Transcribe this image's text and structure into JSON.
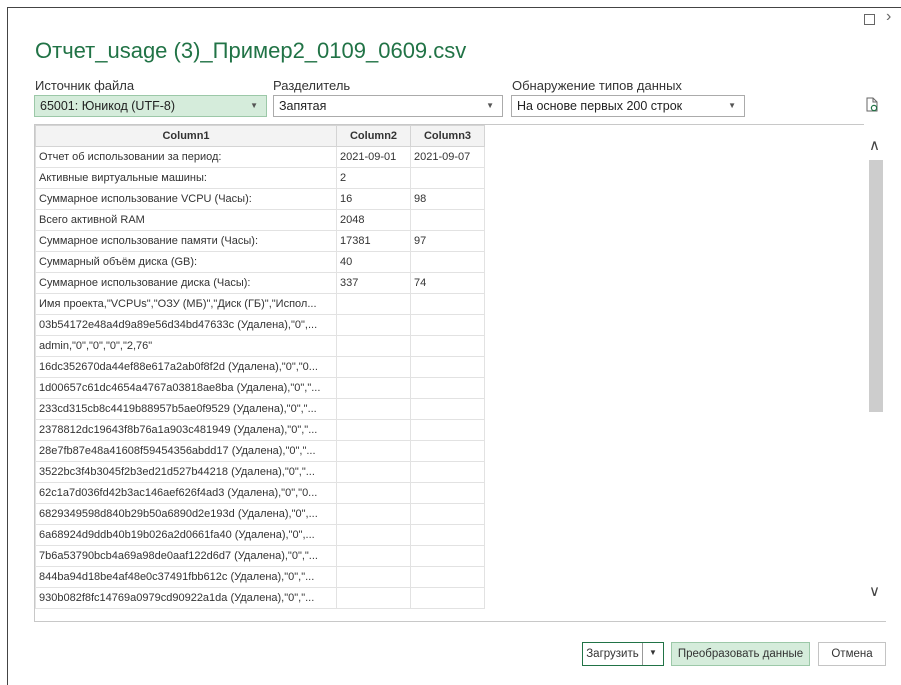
{
  "window": {
    "title": "Отчет_usage (3)_Пример2_0109_0609.csv"
  },
  "options": {
    "file_origin_label": "Источник файла",
    "file_origin_value": "65001: Юникод (UTF-8)",
    "delimiter_label": "Разделитель",
    "delimiter_value": "Запятая",
    "type_detection_label": "Обнаружение типов данных",
    "type_detection_value": "На основе первых 200 строк"
  },
  "table": {
    "headers": [
      "Column1",
      "Column2",
      "Column3"
    ],
    "rows": [
      [
        "Отчет об использовании за период:",
        "2021-09-01",
        "2021-09-07"
      ],
      [
        "Активные виртуальные машины:",
        "2",
        ""
      ],
      [
        "Суммарное использование VCPU (Часы):",
        "16",
        "98"
      ],
      [
        "Всего активной RAM",
        "2048",
        ""
      ],
      [
        "Суммарное использование памяти (Часы):",
        "17381",
        "97"
      ],
      [
        "Суммарный объём диска (GB):",
        "40",
        ""
      ],
      [
        "Суммарное использование диска (Часы):",
        "337",
        "74"
      ],
      [
        "Имя проекта,\"VCPUs\",\"ОЗУ (МБ)\",\"Диск (ГБ)\",\"Испол...",
        "",
        ""
      ],
      [
        "03b54172e48a4d9a89e56d34bd47633c (Удалена),\"0\",...",
        "",
        ""
      ],
      [
        "admin,\"0\",\"0\",\"0\",\"2,76\"",
        "",
        ""
      ],
      [
        "16dc352670da44ef88e617a2ab0f8f2d (Удалена),\"0\",\"0...",
        "",
        ""
      ],
      [
        "1d00657c61dc4654a4767a03818ae8ba (Удалена),\"0\",\"...",
        "",
        ""
      ],
      [
        "233cd315cb8c4419b88957b5ae0f9529 (Удалена),\"0\",\"...",
        "",
        ""
      ],
      [
        "2378812dc19643f8b76a1a903c481949 (Удалена),\"0\",\"...",
        "",
        ""
      ],
      [
        "28e7fb87e48a41608f59454356abdd17 (Удалена),\"0\",\"...",
        "",
        ""
      ],
      [
        "3522bc3f4b3045f2b3ed21d527b44218 (Удалена),\"0\",\"...",
        "",
        ""
      ],
      [
        "62c1a7d036fd42b3ac146aef626f4ad3 (Удалена),\"0\",\"0...",
        "",
        ""
      ],
      [
        "6829349598d840b29b50a6890d2e193d (Удалена),\"0\",...",
        "",
        ""
      ],
      [
        "6a68924d9ddb40b19b026a2d0661fa40 (Удалена),\"0\",...",
        "",
        ""
      ],
      [
        "7b6a53790bcb4a69a98de0aaf122d6d7 (Удалена),\"0\",\"...",
        "",
        ""
      ],
      [
        "844ba94d18be4af48e0c37491fbb612c (Удалена),\"0\",\"...",
        "",
        ""
      ],
      [
        "930b082f8fc14769a0979cd90922a1da (Удалена),\"0\",\"...",
        "",
        ""
      ]
    ]
  },
  "buttons": {
    "load_label": "Загрузить",
    "transform_label": "Преобразовать данные",
    "cancel_label": "Отмена"
  },
  "colors": {
    "accent": "#217346",
    "selected_fill": "#d5ecdb"
  },
  "icons": {
    "maximize": "maximize-icon",
    "next": "chevron-right-icon",
    "refresh": "refresh-icon",
    "scroll_up": "chevron-up-icon",
    "scroll_down": "chevron-down-icon",
    "dropdown": "chevron-down-icon"
  }
}
